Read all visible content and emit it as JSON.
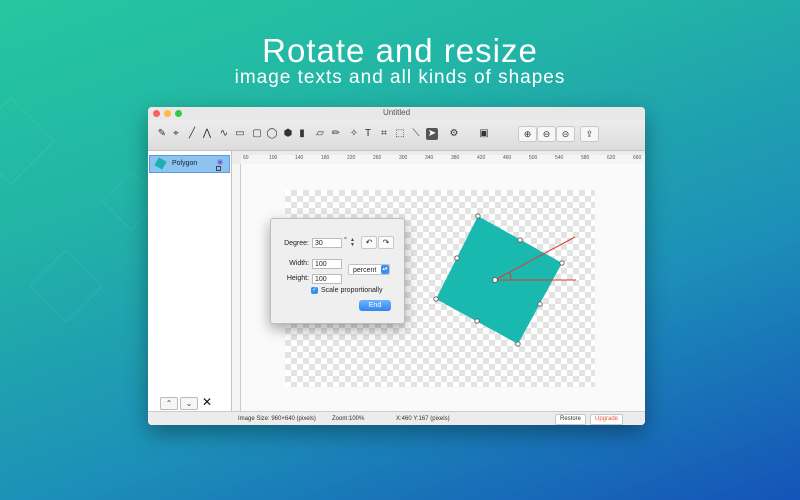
{
  "headline": {
    "title": "Rotate and resize",
    "subtitle": "image texts and all kinds of shapes"
  },
  "window": {
    "title": "Untitled"
  },
  "toolbar": {
    "tools": [
      "eyedropper-icon",
      "brush-icon",
      "line-icon",
      "zigzag-icon",
      "curve-icon",
      "rectangle-icon",
      "rounded-rect-icon",
      "ellipse-icon",
      "hexagon-icon",
      "gradient-icon",
      "eraser-icon",
      "pencil-icon",
      "magic-wand-icon",
      "text-icon",
      "crop-icon",
      "select-rect-icon",
      "line-width-icon",
      "pointer-icon"
    ],
    "tool_glyphs": [
      "✎",
      "⌖",
      "╱",
      "⋀",
      "∿",
      "▭",
      "▢",
      "◯",
      "⬢",
      "▮",
      "▱",
      "✏",
      "✧",
      "T",
      "⌗",
      "⬚",
      "⟍",
      "➤"
    ],
    "zoom": {
      "in": "⊕",
      "fit": "⊖",
      "out": "⊝",
      "share": "⇪"
    }
  },
  "layers": {
    "items": [
      {
        "label": "Polygon"
      }
    ],
    "up": "⌃",
    "down": "⌄",
    "delete": "✕"
  },
  "ruler": {
    "marks": [
      "60",
      "80",
      "100",
      "120",
      "140",
      "160",
      "180",
      "200",
      "220",
      "240",
      "260",
      "280",
      "300",
      "320",
      "340",
      "360",
      "380",
      "400",
      "420",
      "440",
      "460",
      "480",
      "500",
      "520",
      "540",
      "560",
      "580",
      "600",
      "620",
      "640",
      "660"
    ],
    "left_marks": [
      "1",
      "20",
      "40",
      "60",
      "80",
      "100",
      "120",
      "140",
      "160",
      "180"
    ]
  },
  "dialog": {
    "degree_label": "Degree:",
    "degree_value": "30",
    "degree_unit": "°",
    "width_label": "Width:",
    "width_value": "100",
    "height_label": "Height:",
    "height_value": "100",
    "unit_select": "percent",
    "scale_label": "Scale proportionally",
    "scale_checked": true,
    "end_button": "End"
  },
  "status": {
    "image_size": "Image Size: 960×640 (pixels)",
    "zoom": "Zoom:100%",
    "coords": "X:460 Y:167 (pixels)",
    "restore": "Restore",
    "upgrade": "Upgrade"
  },
  "colors": {
    "shape_fill": "#1ab9b0",
    "accent_red": "#e23a2a",
    "upgrade_red": "#e05a3a",
    "selection_blue": "#8cc3ef"
  }
}
